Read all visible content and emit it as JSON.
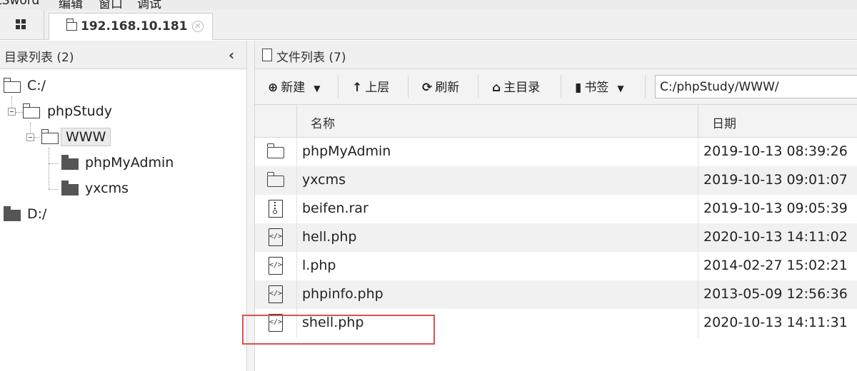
{
  "menubar": {
    "items": [
      "tSword",
      "编辑",
      "窗口",
      "调试"
    ]
  },
  "tab": {
    "label": "192.168.10.181"
  },
  "left": {
    "header": "目录列表 (2)",
    "tree": {
      "c": "C:/",
      "phpstudy": "phpStudy",
      "www": "WWW",
      "phpmyadmin": "phpMyAdmin",
      "yxcms": "yxcms",
      "d": "D:/"
    }
  },
  "right": {
    "header": "文件列表 (7)",
    "toolbar": {
      "new": "新建",
      "up": "上层",
      "refresh": "刷新",
      "home": "主目录",
      "bookmark": "书签"
    },
    "path": "C:/phpStudy/WWW/",
    "columns": {
      "name": "名称",
      "date": "日期"
    },
    "files": [
      {
        "name": "phpMyAdmin",
        "date": "2019-10-13 08:39:26",
        "icon": "folder-icon"
      },
      {
        "name": "yxcms",
        "date": "2019-10-13 09:01:07",
        "icon": "folder-icon"
      },
      {
        "name": "beifen.rar",
        "date": "2019-10-13 09:05:39",
        "icon": "archive-file-icon"
      },
      {
        "name": "hell.php",
        "date": "2020-10-13 14:11:02",
        "icon": "code-file-icon"
      },
      {
        "name": "l.php",
        "date": "2014-02-27 15:02:21",
        "icon": "code-file-icon"
      },
      {
        "name": "phpinfo.php",
        "date": "2013-05-09 12:56:36",
        "icon": "code-file-icon"
      },
      {
        "name": "shell.php",
        "date": "2020-10-13 14:11:31",
        "icon": "code-file-icon"
      }
    ]
  },
  "colors": {
    "highlight": "#d9534f",
    "panel_header": "#f0f0f0",
    "alt_row": "#f1f1f1"
  }
}
